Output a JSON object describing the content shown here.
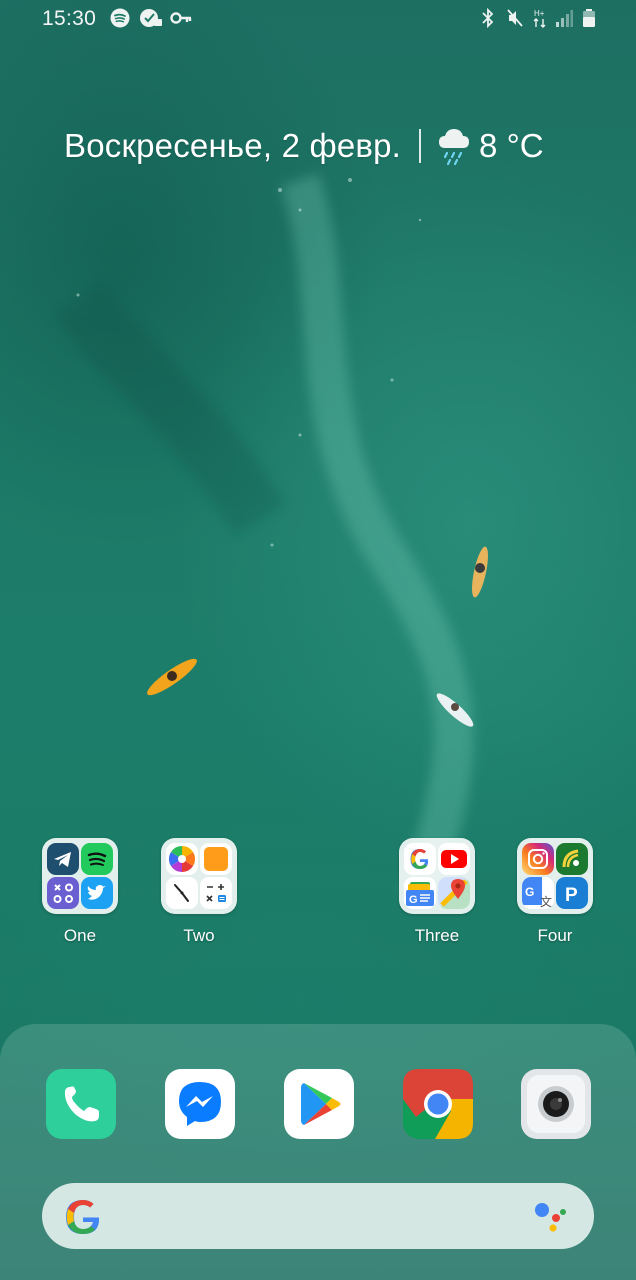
{
  "status_bar": {
    "time": "15:30",
    "left_icons": [
      "spotify-icon",
      "vpn-shield-icon",
      "key-icon"
    ],
    "right_icons": [
      "bluetooth-icon",
      "mute-vibrate-icon",
      "data-arrows-icon",
      "signal-icon",
      "battery-icon"
    ]
  },
  "widget": {
    "date": "Воскресенье, 2 февр.",
    "weather_icon": "rain-cloud-icon",
    "temperature": "8 °C"
  },
  "folders": [
    {
      "label": "One",
      "apps": [
        "telegram-icon",
        "spotify-icon",
        "calculator-app-icon",
        "twitter-icon"
      ]
    },
    {
      "label": "Two",
      "apps": [
        "photos-icon",
        "notes-icon",
        "clock-icon",
        "calculator-icon"
      ]
    },
    {
      "label": "Three",
      "apps": [
        "google-icon",
        "youtube-icon",
        "google-news-icon",
        "maps-icon"
      ]
    },
    {
      "label": "Four",
      "apps": [
        "instagram-icon",
        "feedly-icon",
        "translate-icon",
        "parking-icon"
      ]
    }
  ],
  "dock": {
    "apps": [
      "phone-icon",
      "messenger-icon",
      "play-store-icon",
      "chrome-icon",
      "camera-icon"
    ]
  },
  "search": {
    "placeholder": "",
    "left_icon": "google-g-icon",
    "right_icon": "google-assistant-icon"
  },
  "colors": {
    "wallpaper": "#1c7a66",
    "phone_green": "#2fcf9c",
    "messenger_blue": "#0a7cff",
    "chrome_red": "#db4437",
    "chrome_green": "#0f9d58",
    "chrome_yellow": "#f4b400"
  }
}
